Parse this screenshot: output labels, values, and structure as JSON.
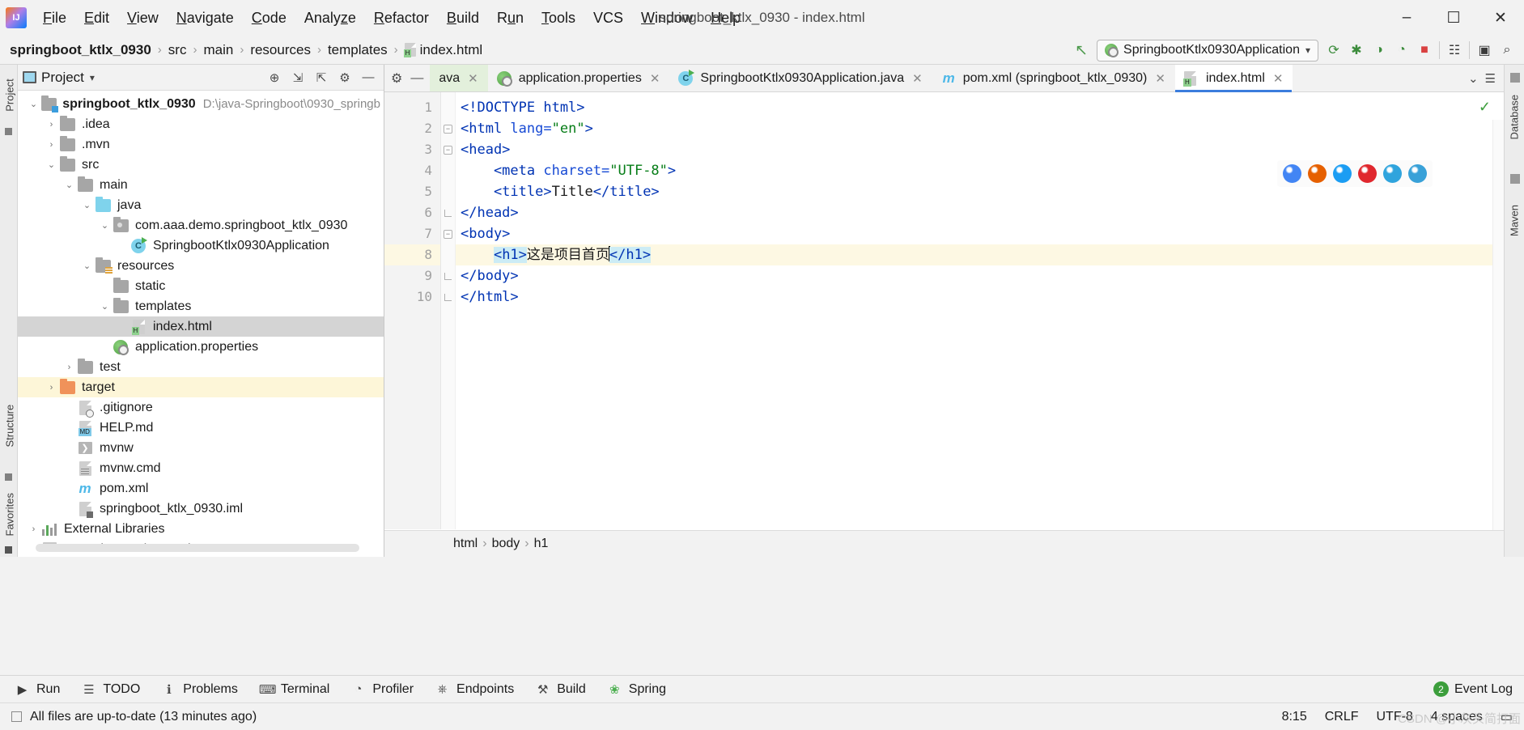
{
  "window": {
    "title": "springboot_ktlx_0930 - index.html",
    "minimize": "–",
    "maximize": "☐",
    "close": "✕"
  },
  "menubar": {
    "items": [
      {
        "label": "File",
        "mnemonic": "F"
      },
      {
        "label": "Edit",
        "mnemonic": "E"
      },
      {
        "label": "View",
        "mnemonic": "V"
      },
      {
        "label": "Navigate",
        "mnemonic": "N"
      },
      {
        "label": "Code",
        "mnemonic": "C"
      },
      {
        "label": "Analyze",
        "mnemonic": "z"
      },
      {
        "label": "Refactor",
        "mnemonic": "R"
      },
      {
        "label": "Build",
        "mnemonic": "B"
      },
      {
        "label": "Run",
        "mnemonic": "u"
      },
      {
        "label": "Tools",
        "mnemonic": "T"
      },
      {
        "label": "VCS",
        "mnemonic": ""
      },
      {
        "label": "Window",
        "mnemonic": "W"
      },
      {
        "label": "Help",
        "mnemonic": "H"
      }
    ]
  },
  "breadcrumb": {
    "separator": "›",
    "items": [
      "springboot_ktlx_0930",
      "src",
      "main",
      "resources",
      "templates",
      "index.html"
    ]
  },
  "navbar_right": {
    "hammer_icon": "↖",
    "run_configuration": "SpringbootKtlx0930Application",
    "dropdown_caret": "▾",
    "icons": [
      {
        "name": "run-icon",
        "glyph": "⟳"
      },
      {
        "name": "debug-icon",
        "glyph": "✱"
      },
      {
        "name": "run-with-coverage-icon",
        "glyph": "◑"
      },
      {
        "name": "profiler-icon",
        "glyph": "◔"
      },
      {
        "name": "stop-icon",
        "glyph": "■"
      },
      {
        "name": "services-icon",
        "glyph": "☷"
      },
      {
        "name": "updates-icon",
        "glyph": "▣"
      },
      {
        "name": "search-everywhere-icon",
        "glyph": "⌕"
      }
    ]
  },
  "left_stripe": {
    "labels": [
      "Project",
      "Structure",
      "Favorites"
    ]
  },
  "right_stripe": {
    "labels": [
      "Database",
      "Maven"
    ]
  },
  "project_panel": {
    "title": "Project",
    "caret": "▾",
    "header_icons": [
      {
        "name": "select-opened-file-icon",
        "glyph": "⊕"
      },
      {
        "name": "expand-all-icon",
        "glyph": "⇲"
      },
      {
        "name": "collapse-all-icon",
        "glyph": "⇱"
      },
      {
        "name": "settings-gear-icon",
        "glyph": "⚙"
      },
      {
        "name": "hide-icon",
        "glyph": "—"
      }
    ],
    "tree": [
      {
        "label": "springboot_ktlx_0930",
        "path": "D:\\java-Springboot\\0930_springb",
        "indent": 0,
        "arrow": "⌄",
        "icon": "folder-module",
        "bold": true,
        "state": "normal"
      },
      {
        "label": ".idea",
        "path": "",
        "indent": 1,
        "arrow": "›",
        "icon": "folder",
        "bold": false,
        "state": "normal"
      },
      {
        "label": ".mvn",
        "path": "",
        "indent": 1,
        "arrow": "›",
        "icon": "folder",
        "bold": false,
        "state": "normal"
      },
      {
        "label": "src",
        "path": "",
        "indent": 1,
        "arrow": "⌄",
        "icon": "folder",
        "bold": false,
        "state": "normal"
      },
      {
        "label": "main",
        "path": "",
        "indent": 2,
        "arrow": "⌄",
        "icon": "folder",
        "bold": false,
        "state": "normal"
      },
      {
        "label": "java",
        "path": "",
        "indent": 3,
        "arrow": "⌄",
        "icon": "folder-source",
        "bold": false,
        "state": "normal"
      },
      {
        "label": "com.aaa.demo.springboot_ktlx_0930",
        "path": "",
        "indent": 4,
        "arrow": "⌄",
        "icon": "folder-package",
        "bold": false,
        "state": "normal"
      },
      {
        "label": "SpringbootKtlx0930Application",
        "path": "",
        "indent": 5,
        "arrow": "",
        "icon": "java-class-run",
        "bold": false,
        "state": "normal"
      },
      {
        "label": "resources",
        "path": "",
        "indent": 3,
        "arrow": "⌄",
        "icon": "folder-resource",
        "bold": false,
        "state": "normal"
      },
      {
        "label": "static",
        "path": "",
        "indent": 4,
        "arrow": "",
        "icon": "folder",
        "bold": false,
        "state": "normal"
      },
      {
        "label": "templates",
        "path": "",
        "indent": 4,
        "arrow": "⌄",
        "icon": "folder",
        "bold": false,
        "state": "normal"
      },
      {
        "label": "index.html",
        "path": "",
        "indent": 5,
        "arrow": "",
        "icon": "file-html",
        "bold": false,
        "state": "selected"
      },
      {
        "label": "application.properties",
        "path": "",
        "indent": 4,
        "arrow": "",
        "icon": "spring-properties",
        "bold": false,
        "state": "normal"
      },
      {
        "label": "test",
        "path": "",
        "indent": 2,
        "arrow": "›",
        "icon": "folder",
        "bold": false,
        "state": "normal"
      },
      {
        "label": "target",
        "path": "",
        "indent": 1,
        "arrow": "›",
        "icon": "folder-excluded",
        "bold": false,
        "state": "highlight"
      },
      {
        "label": ".gitignore",
        "path": "",
        "indent": 2,
        "arrow": "",
        "icon": "file-gitignore",
        "bold": false,
        "state": "normal"
      },
      {
        "label": "HELP.md",
        "path": "",
        "indent": 2,
        "arrow": "",
        "icon": "file-md",
        "bold": false,
        "state": "normal"
      },
      {
        "label": "mvnw",
        "path": "",
        "indent": 2,
        "arrow": "",
        "icon": "file-script",
        "bold": false,
        "state": "normal"
      },
      {
        "label": "mvnw.cmd",
        "path": "",
        "indent": 2,
        "arrow": "",
        "icon": "file-cmd",
        "bold": false,
        "state": "normal"
      },
      {
        "label": "pom.xml",
        "path": "",
        "indent": 2,
        "arrow": "",
        "icon": "file-maven",
        "bold": false,
        "state": "normal"
      },
      {
        "label": "springboot_ktlx_0930.iml",
        "path": "",
        "indent": 2,
        "arrow": "",
        "icon": "file-iml",
        "bold": false,
        "state": "normal"
      },
      {
        "label": "External Libraries",
        "path": "",
        "indent": 0,
        "arrow": "›",
        "icon": "libraries",
        "bold": false,
        "state": "normal"
      },
      {
        "label": "Scratches and Consoles",
        "path": "",
        "indent": 0,
        "arrow": "",
        "icon": "scratches",
        "bold": false,
        "state": "normal"
      }
    ]
  },
  "editor": {
    "tabs": [
      {
        "label": "ava",
        "icon": "java-class",
        "active": false,
        "style": "green",
        "close": "✕"
      },
      {
        "label": "application.properties",
        "icon": "spring-properties",
        "active": false,
        "style": "",
        "close": "✕"
      },
      {
        "label": "SpringbootKtlx0930Application.java",
        "icon": "java-class-run",
        "active": false,
        "style": "",
        "close": "✕"
      },
      {
        "label": "pom.xml (springboot_ktlx_0930)",
        "icon": "file-maven",
        "active": false,
        "style": "",
        "close": "✕"
      },
      {
        "label": "index.html",
        "icon": "file-html",
        "active": true,
        "style": "",
        "close": "✕"
      }
    ],
    "tab_tools": [
      {
        "name": "settings-gear-icon",
        "glyph": "⚙"
      },
      {
        "name": "hide-icon",
        "glyph": "—"
      }
    ],
    "tabs_right": [
      {
        "name": "chevron-down-icon",
        "glyph": "⌄"
      },
      {
        "name": "list-icon",
        "glyph": "☰"
      }
    ],
    "inspection_ok": "✓",
    "browsers": [
      {
        "name": "chrome-browser-icon",
        "color": "#4285f4"
      },
      {
        "name": "firefox-browser-icon",
        "color": "#e66000"
      },
      {
        "name": "safari-browser-icon",
        "color": "#1b9df3"
      },
      {
        "name": "opera-browser-icon",
        "color": "#e0282e"
      },
      {
        "name": "internet-explorer-browser-icon",
        "color": "#2fa4dd"
      },
      {
        "name": "edge-browser-icon",
        "color": "#39a1d8"
      }
    ],
    "lines": [
      {
        "n": "1",
        "fold": "",
        "cur": false,
        "segments": [
          {
            "t": "<!DOCTYPE html>",
            "c": "tag-c",
            "hl": false
          }
        ]
      },
      {
        "n": "2",
        "fold": "minus",
        "cur": false,
        "segments": [
          {
            "t": "<html ",
            "c": "tag-c",
            "hl": false
          },
          {
            "t": "lang=",
            "c": "attr-c",
            "hl": false
          },
          {
            "t": "\"en\"",
            "c": "val-c",
            "hl": false
          },
          {
            "t": ">",
            "c": "tag-c",
            "hl": false
          }
        ]
      },
      {
        "n": "3",
        "fold": "minus",
        "cur": false,
        "segments": [
          {
            "t": "<head>",
            "c": "tag-c",
            "hl": false
          }
        ]
      },
      {
        "n": "4",
        "fold": "",
        "cur": false,
        "segments": [
          {
            "t": "    <meta ",
            "c": "tag-c",
            "hl": false
          },
          {
            "t": "charset=",
            "c": "attr-c",
            "hl": false
          },
          {
            "t": "\"UTF-8\"",
            "c": "val-c",
            "hl": false
          },
          {
            "t": ">",
            "c": "tag-c",
            "hl": false
          }
        ]
      },
      {
        "n": "5",
        "fold": "",
        "cur": false,
        "segments": [
          {
            "t": "    <title>",
            "c": "tag-c",
            "hl": false
          },
          {
            "t": "Title",
            "c": "txt-c",
            "hl": false
          },
          {
            "t": "</title>",
            "c": "tag-c",
            "hl": false
          }
        ]
      },
      {
        "n": "6",
        "fold": "end",
        "cur": false,
        "segments": [
          {
            "t": "</head>",
            "c": "tag-c",
            "hl": false
          }
        ]
      },
      {
        "n": "7",
        "fold": "minus",
        "cur": false,
        "segments": [
          {
            "t": "<body>",
            "c": "tag-c",
            "hl": false
          }
        ]
      },
      {
        "n": "8",
        "fold": "",
        "cur": true,
        "segments": [
          {
            "t": "    ",
            "c": "txt-c",
            "hl": false
          },
          {
            "t": "<h1>",
            "c": "tag-c",
            "hl": true
          },
          {
            "t": "这是项目首页",
            "c": "txt-c",
            "hl": false
          },
          {
            "t": "CARET",
            "c": "caret",
            "hl": false
          },
          {
            "t": "</h1>",
            "c": "tag-c",
            "hl": true
          }
        ]
      },
      {
        "n": "9",
        "fold": "end",
        "cur": false,
        "segments": [
          {
            "t": "</body>",
            "c": "tag-c",
            "hl": false
          }
        ]
      },
      {
        "n": "10",
        "fold": "end",
        "cur": false,
        "segments": [
          {
            "t": "</html>",
            "c": "tag-c",
            "hl": false
          }
        ]
      }
    ],
    "bottom_breadcrumb": [
      "html",
      "body",
      "h1"
    ],
    "bottom_breadcrumb_sep": "›"
  },
  "tool_windows": [
    {
      "label": "Run",
      "icon": "run-icon",
      "glyph": "▶"
    },
    {
      "label": "TODO",
      "icon": "todo-icon",
      "glyph": "☰"
    },
    {
      "label": "Problems",
      "icon": "problems-icon",
      "glyph": "ℹ"
    },
    {
      "label": "Terminal",
      "icon": "terminal-icon",
      "glyph": "⌨"
    },
    {
      "label": "Profiler",
      "icon": "profiler-icon",
      "glyph": "◔"
    },
    {
      "label": "Endpoints",
      "icon": "endpoints-icon",
      "glyph": "⎈"
    },
    {
      "label": "Build",
      "icon": "build-icon",
      "glyph": "⚒"
    },
    {
      "label": "Spring",
      "icon": "spring-icon",
      "glyph": "❀"
    }
  ],
  "event_log": {
    "label": "Event Log",
    "count": "2"
  },
  "statusbar": {
    "message": "All files are up-to-date (13 minutes ago)",
    "caret_position": "8:15",
    "line_separator": "CRLF",
    "encoding": "UTF-8",
    "indent": "4 spaces",
    "watermark": "CSDN @小灰头简打面",
    "lock_icon": "▭"
  },
  "colors": {
    "accent_blue": "#3b7ddd",
    "tag_blue": "#0033b3",
    "attr_value_green": "#067d17",
    "selection_gray": "#d4d4d4",
    "highlight_yellow": "#fdf6d8",
    "caret_line": "#fdf8e3",
    "green_tab": "#e3f0dc"
  }
}
